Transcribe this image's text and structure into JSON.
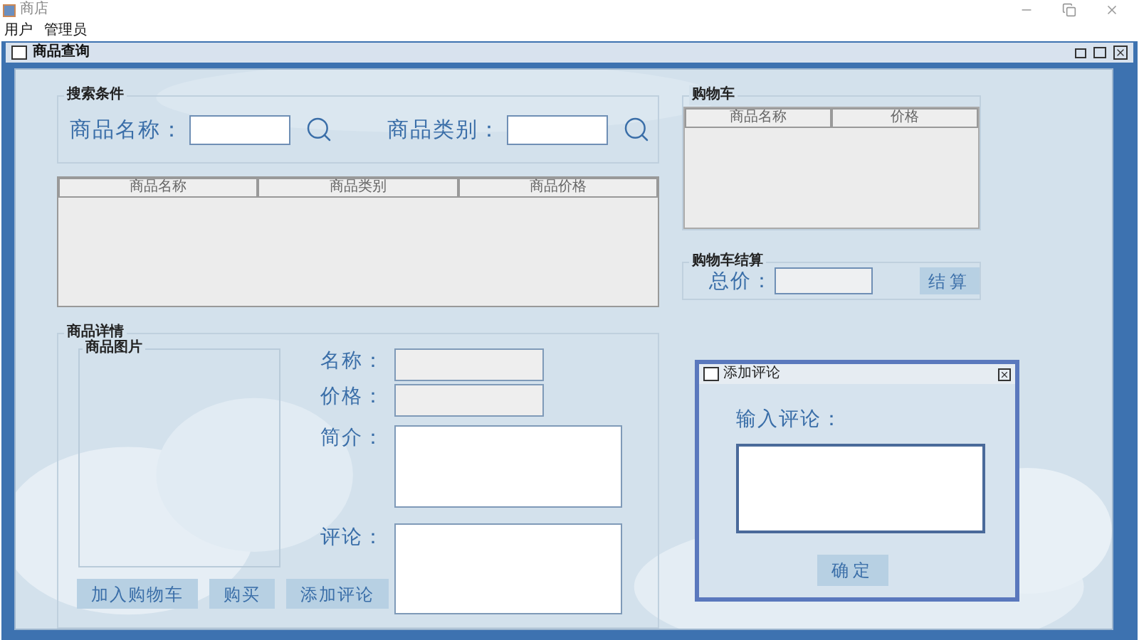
{
  "app_window": {
    "title": "商店"
  },
  "menu": [
    "用户",
    "管理员"
  ],
  "frame": {
    "title": "商品查询"
  },
  "search": {
    "legend": "搜索条件",
    "fields": [
      {
        "label": "商品名称："
      },
      {
        "label": "商品类别："
      }
    ]
  },
  "results_table": {
    "columns": [
      "商品名称",
      "商品类别",
      "商品价格"
    ]
  },
  "cart": {
    "legend": "购物车",
    "columns": [
      "商品名称",
      "价格"
    ]
  },
  "checkout": {
    "legend": "购物车结算",
    "total_label": "总价：",
    "button": "结算"
  },
  "details": {
    "legend": "商品详情",
    "image_legend": "商品图片",
    "fields": [
      {
        "label": "名称：",
        "kind": "text"
      },
      {
        "label": "价格：",
        "kind": "text"
      },
      {
        "label": "简介：",
        "kind": "area"
      },
      {
        "label": "评论：",
        "kind": "area"
      }
    ],
    "buttons": [
      "加入购物车",
      "购买",
      "添加评论"
    ]
  },
  "dialog": {
    "title": "添加评论",
    "prompt": "输入评论：",
    "button": "确定"
  }
}
